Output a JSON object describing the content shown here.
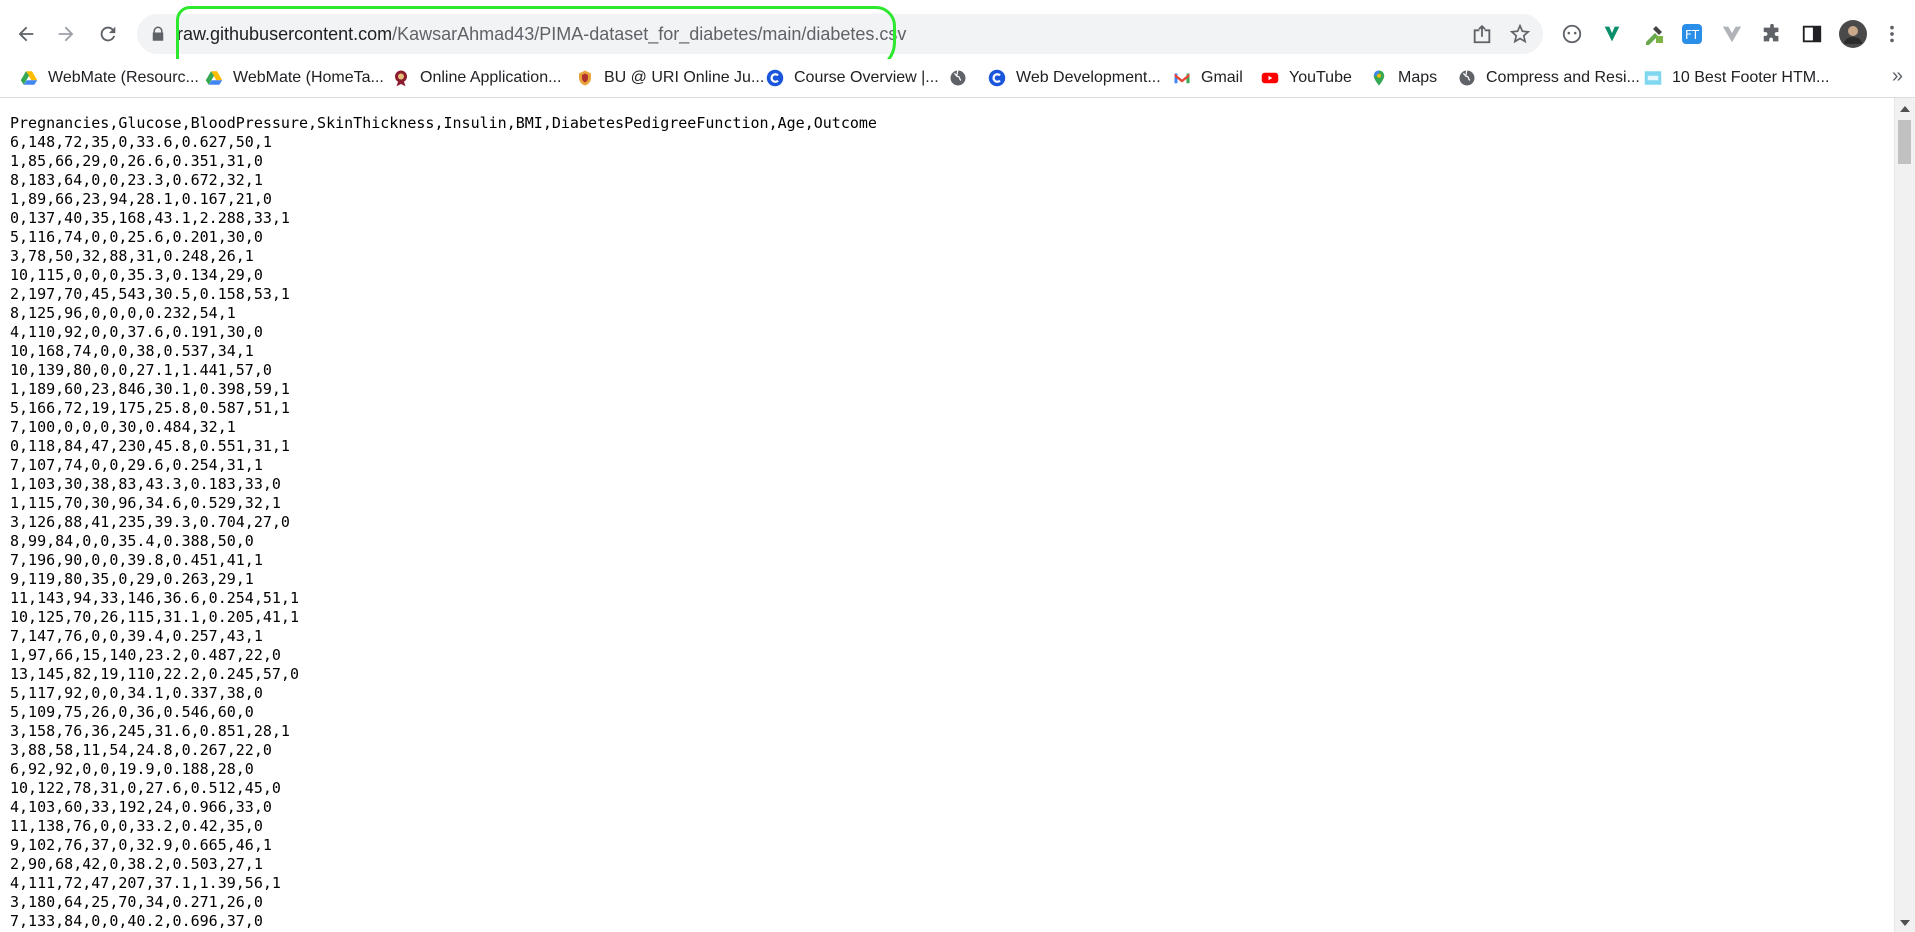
{
  "toolbar": {
    "url_host": "raw.githubusercontent.com",
    "url_path": "/KawsarAhmad43/PIMA-dataset_for_diabetes/main/diabetes.csv",
    "icons": [
      "back-icon",
      "forward-icon",
      "reload-icon",
      "lock-icon",
      "share-icon",
      "bookmark-star-icon",
      "extension-icons",
      "puzzle-icon",
      "side-panel-icon",
      "profile-avatar",
      "kebab-menu-icon"
    ],
    "highlight_color": "#2ee82e"
  },
  "bookmarks": [
    {
      "label": "WebMate (Resourc..."
    },
    {
      "label": "WebMate (HomeTa..."
    },
    {
      "label": "Online Application..."
    },
    {
      "label": "BU @ URI Online Ju..."
    },
    {
      "label": "Course Overview |..."
    },
    {
      "label": ""
    },
    {
      "label": "Web Development..."
    },
    {
      "label": "Gmail"
    },
    {
      "label": "YouTube"
    },
    {
      "label": "Maps"
    },
    {
      "label": "Compress and Resi..."
    },
    {
      "label": "10 Best Footer HTM..."
    }
  ],
  "bookmarks_more": "»",
  "csv": {
    "header": "Pregnancies,Glucose,BloodPressure,SkinThickness,Insulin,BMI,DiabetesPedigreeFunction,Age,Outcome",
    "rows": [
      "6,148,72,35,0,33.6,0.627,50,1",
      "1,85,66,29,0,26.6,0.351,31,0",
      "8,183,64,0,0,23.3,0.672,32,1",
      "1,89,66,23,94,28.1,0.167,21,0",
      "0,137,40,35,168,43.1,2.288,33,1",
      "5,116,74,0,0,25.6,0.201,30,0",
      "3,78,50,32,88,31,0.248,26,1",
      "10,115,0,0,0,35.3,0.134,29,0",
      "2,197,70,45,543,30.5,0.158,53,1",
      "8,125,96,0,0,0,0.232,54,1",
      "4,110,92,0,0,37.6,0.191,30,0",
      "10,168,74,0,0,38,0.537,34,1",
      "10,139,80,0,0,27.1,1.441,57,0",
      "1,189,60,23,846,30.1,0.398,59,1",
      "5,166,72,19,175,25.8,0.587,51,1",
      "7,100,0,0,0,30,0.484,32,1",
      "0,118,84,47,230,45.8,0.551,31,1",
      "7,107,74,0,0,29.6,0.254,31,1",
      "1,103,30,38,83,43.3,0.183,33,0",
      "1,115,70,30,96,34.6,0.529,32,1",
      "3,126,88,41,235,39.3,0.704,27,0",
      "8,99,84,0,0,35.4,0.388,50,0",
      "7,196,90,0,0,39.8,0.451,41,1",
      "9,119,80,35,0,29,0.263,29,1",
      "11,143,94,33,146,36.6,0.254,51,1",
      "10,125,70,26,115,31.1,0.205,41,1",
      "7,147,76,0,0,39.4,0.257,43,1",
      "1,97,66,15,140,23.2,0.487,22,0",
      "13,145,82,19,110,22.2,0.245,57,0",
      "5,117,92,0,0,34.1,0.337,38,0",
      "5,109,75,26,0,36,0.546,60,0",
      "3,158,76,36,245,31.6,0.851,28,1",
      "3,88,58,11,54,24.8,0.267,22,0",
      "6,92,92,0,0,19.9,0.188,28,0",
      "10,122,78,31,0,27.6,0.512,45,0",
      "4,103,60,33,192,24,0.966,33,0",
      "11,138,76,0,0,33.2,0.42,35,0",
      "9,102,76,37,0,32.9,0.665,46,1",
      "2,90,68,42,0,38.2,0.503,27,1",
      "4,111,72,47,207,37.1,1.39,56,1",
      "3,180,64,25,70,34,0.271,26,0",
      "7,133,84,0,0,40.2,0.696,37,0"
    ]
  }
}
